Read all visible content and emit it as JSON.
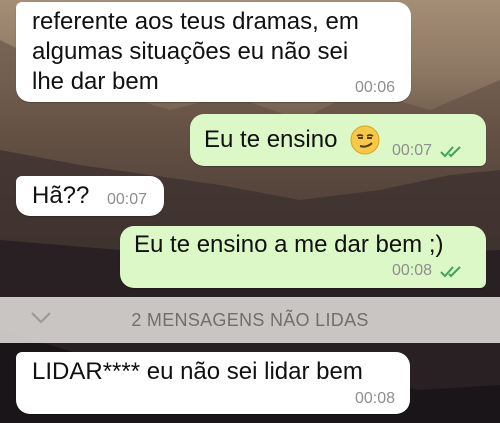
{
  "chat": {
    "messages": [
      {
        "line1": "referente aos teus dramas, em",
        "line2": "algumas situações eu não sei",
        "line3": "lhe dar bem",
        "time": "00:06"
      },
      {
        "text": "Eu te ensino",
        "emoji": "smirk-emoji",
        "time": "00:07",
        "status": "read"
      },
      {
        "text": "Hã??",
        "time": "00:07"
      },
      {
        "text": "Eu te ensino a me dar bem ;)",
        "time": "00:08",
        "status": "read"
      },
      {
        "text": "LIDAR**** eu não sei lidar bem",
        "time": "00:08"
      }
    ],
    "unread_label": "2 MENSAGENS NÃO LIDAS"
  },
  "colors": {
    "incoming_bubble": "#ffffff",
    "outgoing_bubble": "#dcf8c6",
    "read_ticks": "#4fc3f7"
  }
}
